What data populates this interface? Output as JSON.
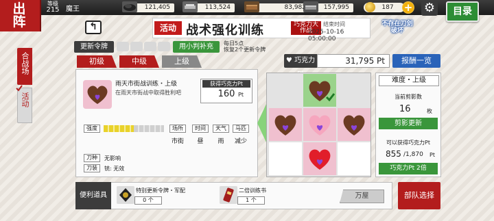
{
  "header": {
    "title": "出\n阵",
    "level_label": "等级",
    "level": "215",
    "player_name": "魔王",
    "resources": [
      {
        "name": "charcoal",
        "value": "121,405"
      },
      {
        "name": "steel",
        "value": "113,524"
      },
      {
        "name": "cooling-material",
        "value": "83,982"
      },
      {
        "name": "whetstone",
        "value": "157,995"
      }
    ],
    "koban": "187",
    "menu_label": "目录"
  },
  "side_tabs": [
    {
      "label": "合战场"
    },
    {
      "label": "活动"
    }
  ],
  "banner": {
    "tag": "活动",
    "title": "战术强化训练",
    "subtitle": "巧克力大作战",
    "end_label": "结束时间",
    "end_date": "2025-10-16 05:00:00"
  },
  "no_sword_notice": "不存在刀剑破坏",
  "refresh": {
    "label": "更新令牌",
    "refill_label": "用小判补充",
    "daily_info_line1": "每日5点",
    "daily_info_line2": "恢复2个更新令牌"
  },
  "difficulty_tabs": [
    "初级",
    "中级",
    "上级"
  ],
  "points": {
    "label": "巧克力Pt",
    "value": "31,795",
    "unit": "Pt",
    "reward_button": "报酬一览"
  },
  "stage": {
    "name": "雨天市街战训练・上级",
    "description": "在雨天市街战中取得胜利吧",
    "gain_label": "获得巧克力Pt",
    "gain_value": "160",
    "gain_unit": "Pt",
    "intensity_label": "强度",
    "intensity_fraction": 0.5,
    "stat_labels": [
      "场所",
      "时间",
      "天气",
      "马匹"
    ],
    "stat_values": [
      "市街",
      "昼",
      "雨",
      "减少"
    ],
    "blade_type_label": "刀种",
    "blade_type_value": "无影响",
    "sword_equip_label": "刀装",
    "sword_equip_value": "铳: 无效"
  },
  "info": {
    "difficulty": "难度・上级",
    "current_cards_label": "当前剪影数",
    "current_cards": "16",
    "current_cards_unit": "枚",
    "shuffle_button": "剪影更新",
    "can_obtain_label": "可以获得巧克力Pt",
    "can_obtain_value": "855",
    "can_obtain_max": "/1,870",
    "can_obtain_unit": "Pt",
    "x2_button": "巧克力Pt 2倍"
  },
  "bottom": {
    "items_label": "便利道具",
    "item1_name": "特别更新令牌・军配",
    "item1_count": "0 个",
    "item2_name": "二倍训练书",
    "item2_count": "1 个",
    "shop_button": "万屋",
    "team_button": "部队选择"
  },
  "colors": {
    "accent_red": "#b31d1d",
    "green": "#3a963b",
    "blue": "#2a63b9"
  }
}
